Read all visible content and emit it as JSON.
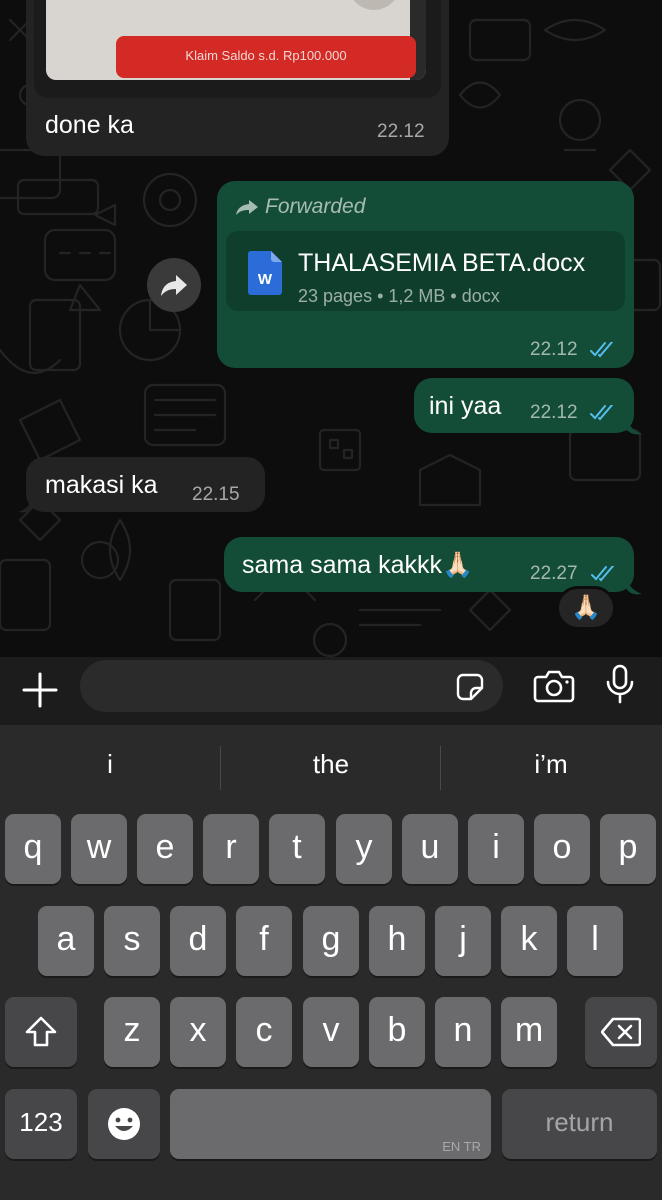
{
  "chat": {
    "image_message": {
      "embedded_button_text": "Klaim Saldo s.d. Rp100.000",
      "caption": "done ka",
      "time": "22.12"
    },
    "forwarded_message": {
      "forwarded_label": "Forwarded",
      "document_name": "THALASEMIA BETA.docx",
      "document_meta": "23 pages • 1,2 MB • docx",
      "document_icon_letter": "W",
      "time": "22.12",
      "status": "read"
    },
    "messages": [
      {
        "direction": "out",
        "text": "ini yaa",
        "time": "22.12",
        "status": "read"
      },
      {
        "direction": "in",
        "text": "makasi ka",
        "time": "22.15"
      },
      {
        "direction": "out",
        "text": "sama sama kakkk🙏🏻",
        "time": "22.27",
        "status": "read"
      }
    ],
    "reaction": "🙏🏻"
  },
  "input_bar": {
    "message_placeholder": "",
    "icons": [
      "plus-icon",
      "sticker-icon",
      "camera-icon",
      "microphone-icon"
    ]
  },
  "keyboard": {
    "suggestions": [
      "i",
      "the",
      "i’m"
    ],
    "row1": [
      "q",
      "w",
      "e",
      "r",
      "t",
      "y",
      "u",
      "i",
      "o",
      "p"
    ],
    "row2": [
      "a",
      "s",
      "d",
      "f",
      "g",
      "h",
      "j",
      "k",
      "l"
    ],
    "row3": [
      "z",
      "x",
      "c",
      "v",
      "b",
      "n",
      "m"
    ],
    "numbers_label": "123",
    "space_language": "EN TR",
    "return_label": "return"
  },
  "colors": {
    "outgoing_bubble": "#144d37",
    "incoming_bubble": "#232323",
    "read_ticks": "#53bdeb",
    "word_icon": "#2b6cd8"
  }
}
